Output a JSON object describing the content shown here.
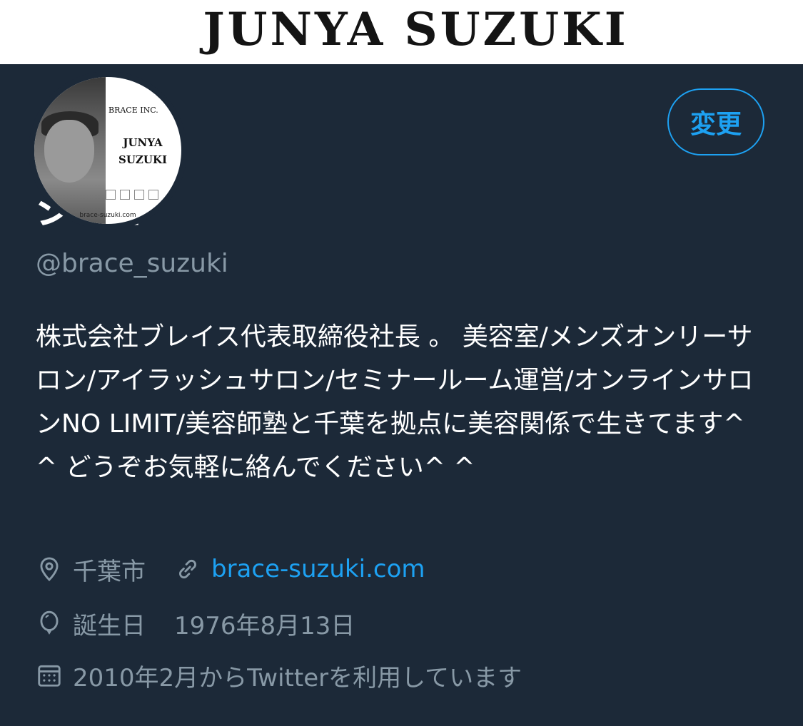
{
  "banner": {
    "text": "JUNYA SUZUKI"
  },
  "avatar": {
    "company": "BRACE INC.",
    "name_line1": "JUNYA",
    "name_line2": "SUZUKI",
    "url": "brace-suzuki.com"
  },
  "profile": {
    "edit_label": "変更",
    "display_name": "ジャイ",
    "handle": "@brace_suzuki",
    "bio": "株式会社ブレイス代表取締役社長 。 美容室/メンズオンリーサロン/アイラッシュサロン/セミナールーム運営/オンラインサロンNO LIMIT/美容師塾と千葉を拠点に美容関係で生きてます^ ^ どうぞお気軽に絡んでください^ ^",
    "location": "千葉市",
    "website": "brace-suzuki.com",
    "birthday_label": "誕生日",
    "birthday": "1976年8月13日",
    "joined": "2010年2月からTwitterを利用しています"
  },
  "colors": {
    "background": "#1c2938",
    "accent": "#1da1f2",
    "secondary_text": "#8899a6"
  },
  "icons": [
    "location-pin-icon",
    "link-icon",
    "balloon-icon",
    "calendar-icon"
  ]
}
